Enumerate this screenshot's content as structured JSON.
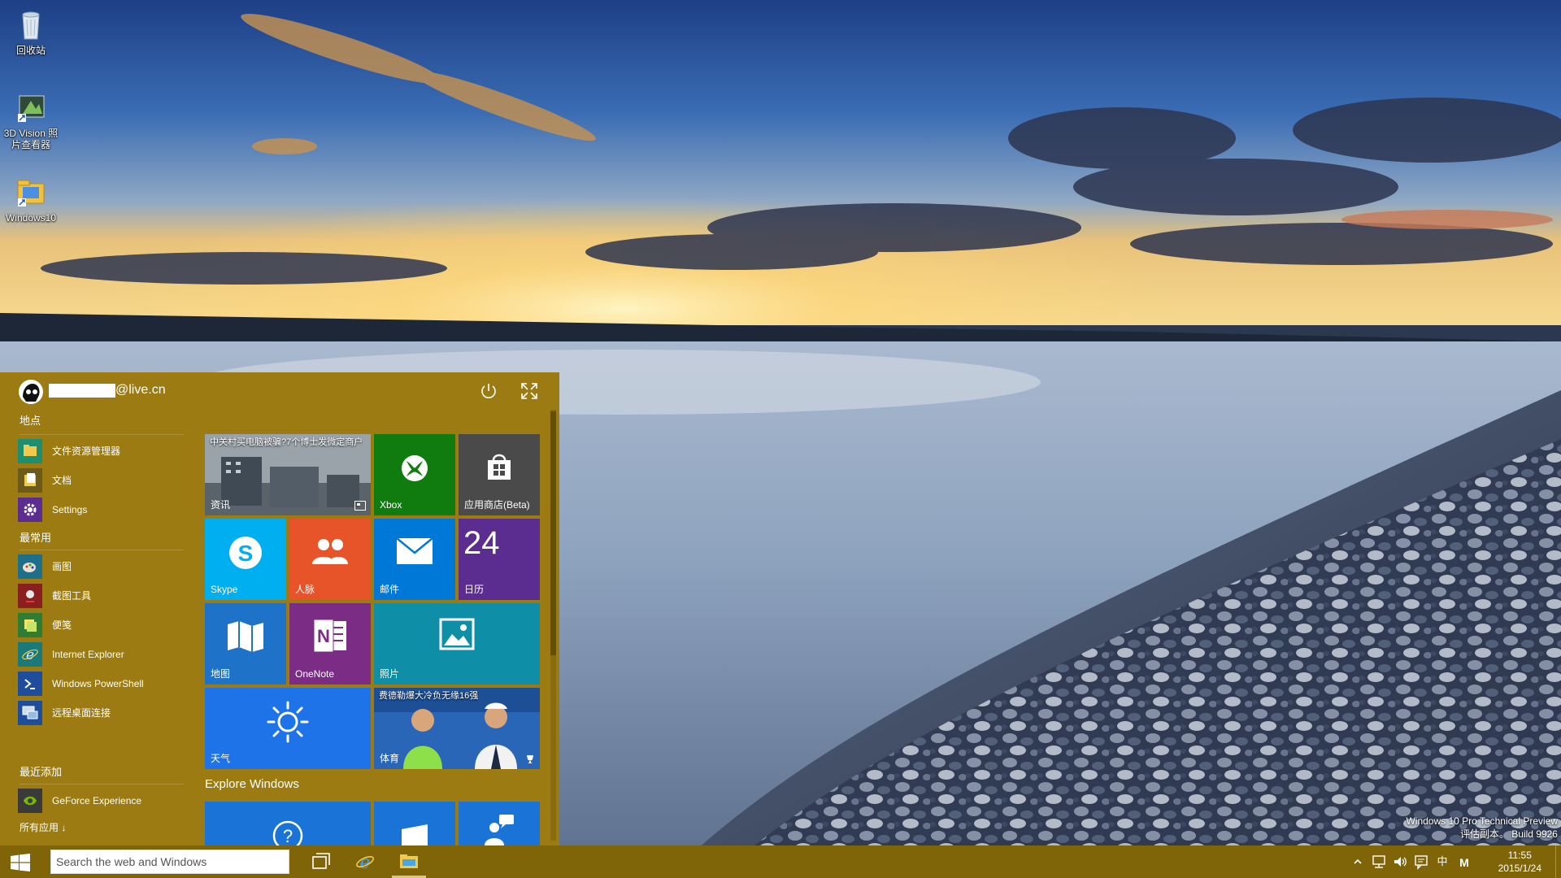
{
  "desktop": {
    "icons": [
      {
        "label": "回收站"
      },
      {
        "label_line1": "3D Vision 照",
        "label_line2": "片查看器"
      },
      {
        "label": "Windows10"
      }
    ]
  },
  "start_menu": {
    "user_suffix": "@live.cn",
    "sections": {
      "places": "地点",
      "most_used": "最常用",
      "recently_added": "最近添加"
    },
    "places_items": [
      {
        "label": "文件资源管理器"
      },
      {
        "label": "文档"
      },
      {
        "label": "Settings"
      }
    ],
    "most_used_items": [
      {
        "label": "画图"
      },
      {
        "label": "截图工具"
      },
      {
        "label": "便笺"
      },
      {
        "label": "Internet Explorer"
      },
      {
        "label": "Windows PowerShell"
      },
      {
        "label": "远程桌面连接"
      }
    ],
    "recent_items": [
      {
        "label": "GeForce Experience"
      }
    ],
    "all_apps": "所有应用 ↓",
    "tiles": {
      "news": {
        "label": "资讯",
        "headline": "中关村买电脑被骗?7个博士发微定商户"
      },
      "xbox": {
        "label": "Xbox"
      },
      "store": {
        "label": "应用商店(Beta)"
      },
      "skype": {
        "label": "Skype"
      },
      "people": {
        "label": "人脉"
      },
      "mail": {
        "label": "邮件"
      },
      "calendar": {
        "label": "日历",
        "day": "24"
      },
      "maps": {
        "label": "地图"
      },
      "onenote": {
        "label": "OneNote"
      },
      "photos": {
        "label": "照片"
      },
      "weather": {
        "label": "天气"
      },
      "sports": {
        "label": "体育",
        "headline": "费德勒爆大冷负无缘16强"
      }
    },
    "explore_title": "Explore Windows"
  },
  "watermark": {
    "line1": "Windows 10 Pro Technical Preview",
    "line2": "评估副本。 Build 9926"
  },
  "taskbar": {
    "search_placeholder": "Search the web and Windows",
    "time": "11:55",
    "date": "2015/1/24",
    "ime": "中",
    "ime_mode": "M"
  },
  "colors": {
    "accent": "#9c7b12",
    "taskbar": "#7f6408",
    "xbox": "#107c10",
    "skype": "#00aff0",
    "people": "#e8542a",
    "mail": "#0078d7",
    "calendar": "#5c2d91",
    "onenote": "#7b2d86",
    "photos": "#0f8ea8",
    "weather": "#1e73e8"
  }
}
